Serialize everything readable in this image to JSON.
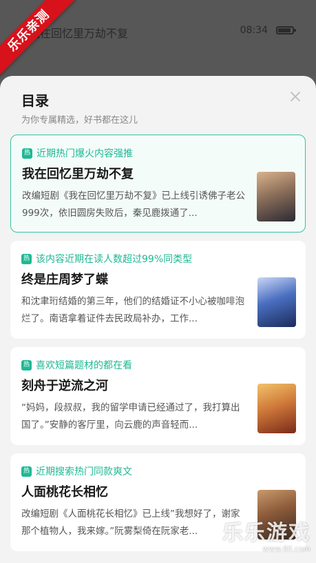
{
  "reader": {
    "title": "我在回忆里万劫不复",
    "time": "08:34"
  },
  "ribbon": {
    "text": "乐乐亲测"
  },
  "sheet": {
    "title": "目录",
    "subtitle": "为你专属精选，好书都在这儿"
  },
  "hot_badge": "热",
  "cards": [
    {
      "tag": "近期热门爆火内容强推",
      "title": "我在回忆里万劫不复",
      "desc": "改编短剧《我在回忆里万劫不复》已上线引诱佛子老公999次，依旧圆房失败后，秦见鹿拨通了...",
      "cover_colors": [
        "#2b2a33",
        "#8c6f5a",
        "#d9b38c"
      ]
    },
    {
      "tag": "该内容近期在读人数超过99%同类型",
      "title": "终是庄周梦了蝶",
      "desc": "和沈聿珩结婚的第三年，他们的结婚证不小心被咖啡泡烂了。南语拿着证件去民政局补办，工作...",
      "cover_colors": [
        "#1b2b5a",
        "#4a6fc0",
        "#c9d6f5"
      ]
    },
    {
      "tag": "喜欢短篇题材的都在看",
      "title": "刻舟于逆流之河",
      "desc": "“妈妈，段叔叔，我的留学申请已经通过了，我打算出国了。”安静的客厅里，向云鹿的声音轻而...",
      "cover_colors": [
        "#7a2a1a",
        "#d07a3a",
        "#f2c36a"
      ]
    },
    {
      "tag": "近期搜索热门同款爽文",
      "title": "人面桃花长相忆",
      "desc": "改编短剧《人面桃花长相忆》已上线”我想好了，谢家那个植物人，我来嫁。”阮雾梨倚在阮家老...",
      "cover_colors": [
        "#3a2a20",
        "#8a5a3a",
        "#c89a6a"
      ]
    }
  ],
  "watermark": {
    "text": "乐乐游戏",
    "url": "www.6ll.com"
  }
}
